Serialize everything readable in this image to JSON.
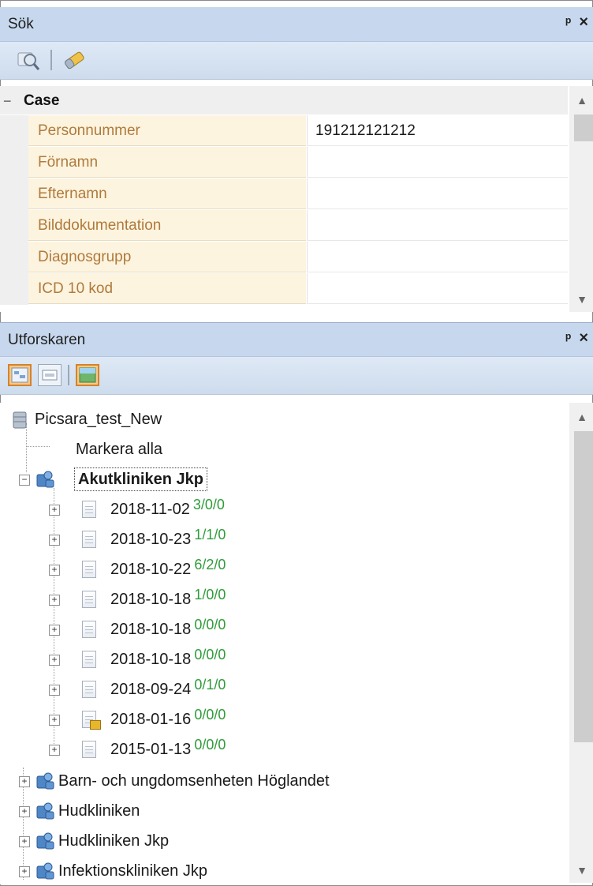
{
  "search_panel": {
    "title": "Sök",
    "pin_glyph": "ᵖ",
    "close_glyph": "×",
    "toolbar": [
      "search-icon",
      "eraser-icon"
    ],
    "category": {
      "toggle": "−",
      "label": "Case"
    },
    "rows": [
      {
        "name": "Personnummer",
        "value": "191212121212"
      },
      {
        "name": "Förnamn",
        "value": ""
      },
      {
        "name": "Efternamn",
        "value": ""
      },
      {
        "name": "Bilddokumentation",
        "value": ""
      },
      {
        "name": "Diagnosgrupp",
        "value": ""
      },
      {
        "name": "ICD 10 kod",
        "value": ""
      }
    ]
  },
  "explorer_panel": {
    "title": "Utforskaren",
    "pin_glyph": "ᵖ",
    "close_glyph": "×",
    "toolbar": [
      "tree-view-icon",
      "list-view-icon",
      "image-view-icon"
    ],
    "root": {
      "label": "Picsara_test_New"
    },
    "select_all": "Markera alla",
    "expanded_clinic": {
      "label": "Akutkliniken Jkp",
      "sessions": [
        {
          "date": "2018-11-02",
          "counts": "3/0/0",
          "locked": false
        },
        {
          "date": "2018-10-23",
          "counts": "1/1/0",
          "locked": false
        },
        {
          "date": "2018-10-22",
          "counts": "6/2/0",
          "locked": false
        },
        {
          "date": "2018-10-18",
          "counts": "1/0/0",
          "locked": false
        },
        {
          "date": "2018-10-18",
          "counts": "0/0/0",
          "locked": false
        },
        {
          "date": "2018-10-18",
          "counts": "0/0/0",
          "locked": false
        },
        {
          "date": "2018-09-24",
          "counts": "0/1/0",
          "locked": false
        },
        {
          "date": "2018-01-16",
          "counts": "0/0/0",
          "locked": true
        },
        {
          "date": "2015-01-13",
          "counts": "0/0/0",
          "locked": false
        }
      ]
    },
    "other_clinics": [
      "Barn- och ungdomsenheten Höglandet",
      "Hudkliniken",
      "Hudkliniken Jkp",
      "Infektionskliniken Jkp"
    ]
  },
  "colors": {
    "header_bg": "#c7d8ee",
    "property_name_bg": "#fdf4e0",
    "property_name_text": "#b07a3a",
    "count_text": "#2f9c3a"
  }
}
